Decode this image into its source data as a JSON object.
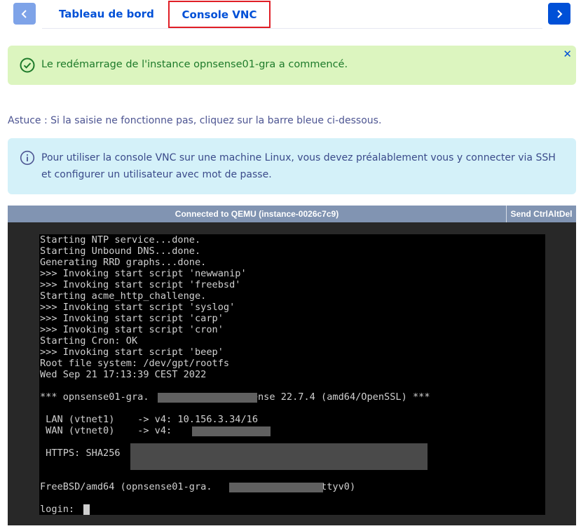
{
  "nav": {
    "prev_icon": "chevron-left-icon",
    "next_icon": "chevron-right-icon"
  },
  "tabs": [
    {
      "label": "Tableau de bord"
    },
    {
      "label": "Console VNC"
    }
  ],
  "alert_success": {
    "message": "Le redémarrage de l'instance opnsense01-gra a commencé.",
    "icon": "check-circle-icon",
    "color": "#1d7a2a"
  },
  "tip": "Astuce : Si la saisie ne fonctionne pas, cliquez sur la barre bleue ci-dessous.",
  "alert_info": {
    "message": "Pour utiliser la console VNC sur une machine Linux, vous devez préalablement vous y connecter via SSH et configurer un utilisateur avec mot de passe.",
    "icon": "info-circle-icon"
  },
  "vnc": {
    "status": "Connected to QEMU (instance-0026c7c9)",
    "ctrl_alt_del": "Send CtrlAltDel",
    "console_lines": [
      "Starting NTP service...done.",
      "Starting Unbound DNS...done.",
      "Generating RRD graphs...done.",
      ">>> Invoking start script 'newwanip'",
      ">>> Invoking start script 'freebsd'",
      "Starting acme_http_challenge.",
      ">>> Invoking start script 'syslog'",
      ">>> Invoking start script 'carp'",
      ">>> Invoking start script 'cron'",
      "Starting Cron: OK",
      ">>> Invoking start script 'beep'",
      "Root file system: /dev/gpt/rootfs",
      "Wed Sep 21 17:13:39 CEST 2022",
      "",
      "*** opnsense01-gra.            : OPNsense 22.7.4 (amd64/OpenSSL) ***",
      "",
      " LAN (vtnet1)    -> v4: 10.156.3.34/16",
      " WAN (vtnet0)    -> v4:              /32",
      "",
      " HTTPS: SHA256",
      "",
      "",
      "FreeBSD/amd64 (opnsense01-gra.                ) (ttyv0)",
      "",
      "login: "
    ]
  }
}
